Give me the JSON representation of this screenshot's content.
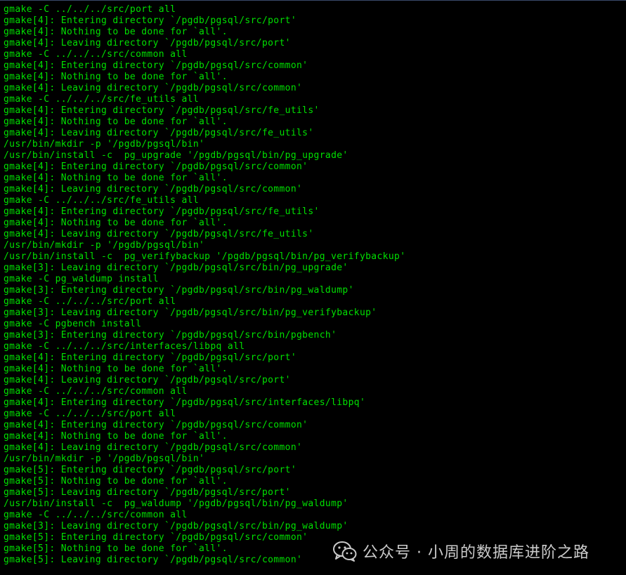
{
  "terminal": {
    "text_color": "#00e000",
    "background": "#000000",
    "lines": [
      "gmake -C ../../../src/port all",
      "gmake[4]: Entering directory `/pgdb/pgsql/src/port'",
      "gmake[4]: Nothing to be done for `all'.",
      "gmake[4]: Leaving directory `/pgdb/pgsql/src/port'",
      "gmake -C ../../../src/common all",
      "gmake[4]: Entering directory `/pgdb/pgsql/src/common'",
      "gmake[4]: Nothing to be done for `all'.",
      "gmake[4]: Leaving directory `/pgdb/pgsql/src/common'",
      "gmake -C ../../../src/fe_utils all",
      "gmake[4]: Entering directory `/pgdb/pgsql/src/fe_utils'",
      "gmake[4]: Nothing to be done for `all'.",
      "gmake[4]: Leaving directory `/pgdb/pgsql/src/fe_utils'",
      "/usr/bin/mkdir -p '/pgdb/pgsql/bin'",
      "/usr/bin/install -c  pg_upgrade '/pgdb/pgsql/bin/pg_upgrade'",
      "gmake[4]: Entering directory `/pgdb/pgsql/src/common'",
      "gmake[4]: Nothing to be done for `all'.",
      "gmake[4]: Leaving directory `/pgdb/pgsql/src/common'",
      "gmake -C ../../../src/fe_utils all",
      "gmake[4]: Entering directory `/pgdb/pgsql/src/fe_utils'",
      "gmake[4]: Nothing to be done for `all'.",
      "gmake[4]: Leaving directory `/pgdb/pgsql/src/fe_utils'",
      "/usr/bin/mkdir -p '/pgdb/pgsql/bin'",
      "/usr/bin/install -c  pg_verifybackup '/pgdb/pgsql/bin/pg_verifybackup'",
      "gmake[3]: Leaving directory `/pgdb/pgsql/src/bin/pg_upgrade'",
      "gmake -C pg_waldump install",
      "gmake[3]: Entering directory `/pgdb/pgsql/src/bin/pg_waldump'",
      "gmake -C ../../../src/port all",
      "gmake[3]: Leaving directory `/pgdb/pgsql/src/bin/pg_verifybackup'",
      "gmake -C pgbench install",
      "gmake[3]: Entering directory `/pgdb/pgsql/src/bin/pgbench'",
      "gmake -C ../../../src/interfaces/libpq all",
      "gmake[4]: Entering directory `/pgdb/pgsql/src/port'",
      "gmake[4]: Nothing to be done for `all'.",
      "gmake[4]: Leaving directory `/pgdb/pgsql/src/port'",
      "gmake -C ../../../src/common all",
      "gmake[4]: Entering directory `/pgdb/pgsql/src/interfaces/libpq'",
      "gmake -C ../../../src/port all",
      "gmake[4]: Entering directory `/pgdb/pgsql/src/common'",
      "gmake[4]: Nothing to be done for `all'.",
      "gmake[4]: Leaving directory `/pgdb/pgsql/src/common'",
      "/usr/bin/mkdir -p '/pgdb/pgsql/bin'",
      "gmake[5]: Entering directory `/pgdb/pgsql/src/port'",
      "gmake[5]: Nothing to be done for `all'.",
      "gmake[5]: Leaving directory `/pgdb/pgsql/src/port'",
      "/usr/bin/install -c  pg_waldump '/pgdb/pgsql/bin/pg_waldump'",
      "gmake -C ../../../src/common all",
      "gmake[3]: Leaving directory `/pgdb/pgsql/src/bin/pg_waldump'",
      "gmake[5]: Entering directory `/pgdb/pgsql/src/common'",
      "gmake[5]: Nothing to be done for `all'.",
      "gmake[5]: Leaving directory `/pgdb/pgsql/src/common'"
    ]
  },
  "watermark": {
    "icon": "wechat-icon",
    "text": "公众号 · 小周的数据库进阶之路"
  }
}
